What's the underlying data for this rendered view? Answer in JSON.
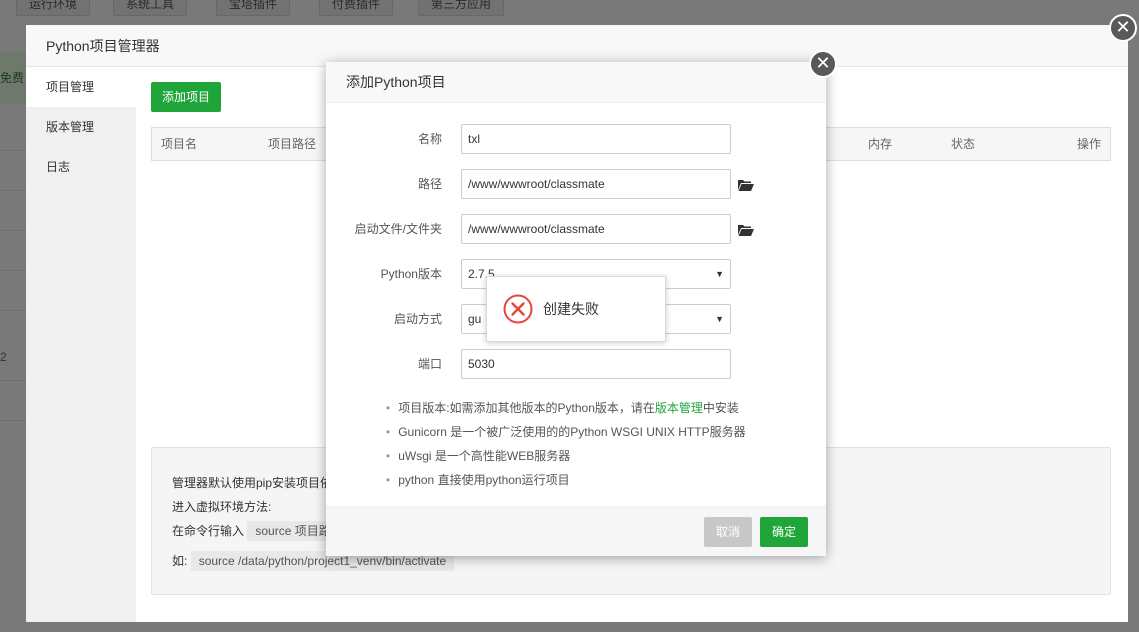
{
  "background": {
    "tabs": [
      "运行环境",
      "系统工具",
      "宝塔插件",
      "付费插件",
      "第三方应用"
    ],
    "left_banner_text": "免费",
    "left_number": "2"
  },
  "manager": {
    "title": "Python项目管理器",
    "sidebar": [
      {
        "label": "项目管理",
        "active": true
      },
      {
        "label": "版本管理",
        "active": false
      },
      {
        "label": "日志",
        "active": false
      }
    ],
    "add_button": "添加项目",
    "table_headers": [
      "项目名",
      "项目路径",
      "内存",
      "状态",
      "操作"
    ],
    "info": {
      "line1": "管理器默认使用pip安装项目依",
      "line2": "进入虚拟环境方法:",
      "line3_prefix": "在命令行输入",
      "line3_code": "source 项目路",
      "line4_prefix": "如:",
      "line4_code": "source /data/python/project1_venv/bin/activate"
    }
  },
  "dialog": {
    "title": "添加Python项目",
    "fields": {
      "name_label": "名称",
      "name_value": "txl",
      "path_label": "路径",
      "path_value": "/www/wwwroot/classmate",
      "startup_label": "启动文件/文件夹",
      "startup_value": "/www/wwwroot/classmate",
      "version_label": "Python版本",
      "version_value": "2.7.5",
      "mode_label": "启动方式",
      "mode_value": "gu",
      "port_label": "端口",
      "port_value": "5030"
    },
    "tips": {
      "tip1_prefix": "项目版本:如需添加其他版本的Python版本，请在",
      "tip1_link": "版本管理",
      "tip1_suffix": "中安装",
      "tip2": "Gunicorn 是一个被广泛使用的的Python WSGI UNIX HTTP服务器",
      "tip3": "uWsgi 是一个高性能WEB服务器",
      "tip4": "python 直接使用python运行项目"
    },
    "cancel_button": "取消",
    "confirm_button": "确定"
  },
  "toast": {
    "message": "创建失败",
    "icon": "error-circle-icon"
  },
  "colors": {
    "accent_green": "#20a53a",
    "error_red": "#e5453c"
  }
}
